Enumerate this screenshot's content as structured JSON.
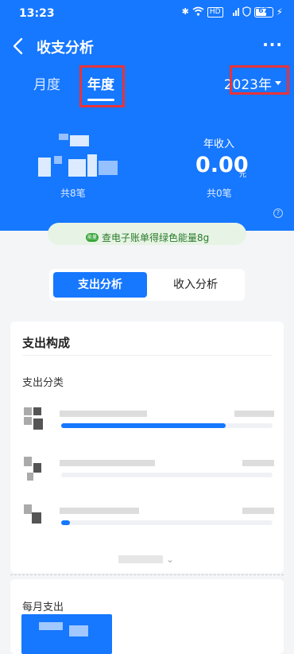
{
  "status_bar": {
    "time": "13:23",
    "hd_label": "HD",
    "signal_label": "5G",
    "battery_level": "67"
  },
  "nav": {
    "title": "收支分析",
    "more_label": "···"
  },
  "tabs": {
    "month": "月度",
    "year": "年度"
  },
  "year_selector": {
    "value": "2023年"
  },
  "summary": {
    "expense_count": "共8笔",
    "income_label": "年收入",
    "income_value": "0.00",
    "income_unit": "元",
    "income_count": "共0笔",
    "help_icon": "?"
  },
  "banner": {
    "badge": "能量",
    "text": "查电子账单得绿色能量8g"
  },
  "segment": {
    "expense": "支出分析",
    "income": "收入分析"
  },
  "composition": {
    "title": "支出构成",
    "category_title": "支出分类",
    "rows": [
      {
        "bar_fraction": 0.78
      },
      {
        "bar_fraction": 0.0
      },
      {
        "bar_fraction": 0.04
      }
    ],
    "expand_chevron": "⌄"
  },
  "monthly": {
    "title": "每月支出"
  },
  "colors": {
    "primary": "#1677ff",
    "highlight_box": "#e8333a",
    "energy_green": "#3aa63a"
  }
}
